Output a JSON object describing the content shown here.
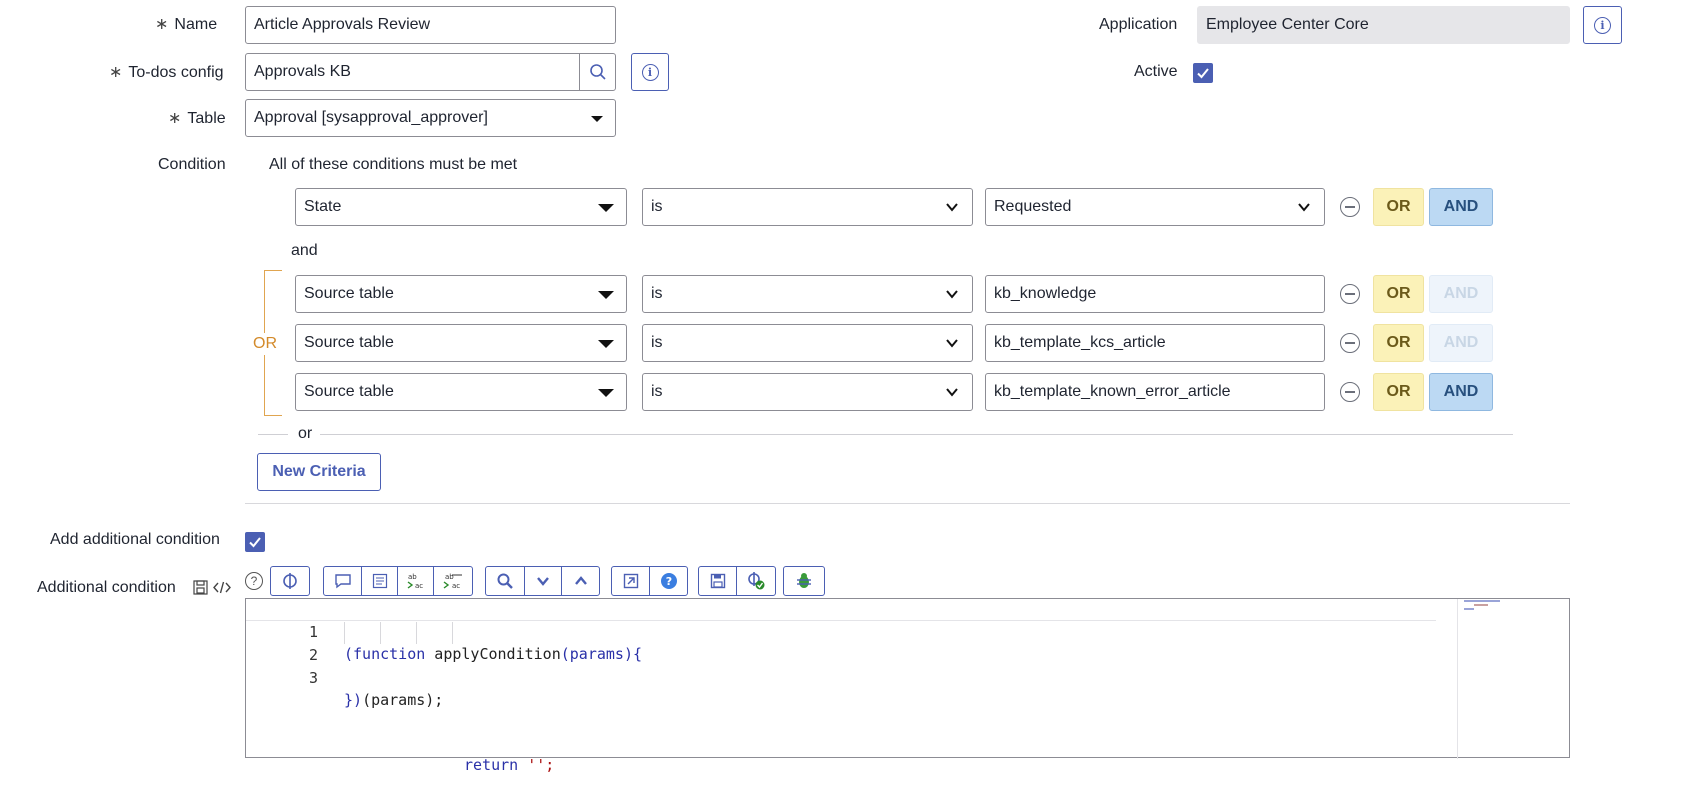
{
  "form": {
    "name_label": "Name",
    "name_value": "Article Approvals Review",
    "todos_label": "To-dos config",
    "todos_value": "Approvals KB",
    "table_label": "Table",
    "table_value": "Approval [sysapproval_approver]",
    "application_label": "Application",
    "application_value": "Employee Center Core",
    "active_label": "Active",
    "active_checked": true,
    "required_marker": "∗"
  },
  "condition": {
    "label": "Condition",
    "header": "All of these conditions must be met",
    "and_text": "and",
    "or_group_label": "OR",
    "or_separator": "or",
    "or_btn": "OR",
    "and_btn": "AND",
    "new_criteria": "New Criteria",
    "rows": [
      {
        "field": "State",
        "operator": "is",
        "value": "Requested",
        "value_type": "select",
        "and_enabled": true
      },
      {
        "field": "Source table",
        "operator": "is",
        "value": "kb_knowledge",
        "value_type": "text",
        "and_enabled": false
      },
      {
        "field": "Source table",
        "operator": "is",
        "value": "kb_template_kcs_article",
        "value_type": "text",
        "and_enabled": false
      },
      {
        "field": "Source table",
        "operator": "is",
        "value": "kb_template_known_error_article",
        "value_type": "text",
        "and_enabled": true
      }
    ]
  },
  "additional": {
    "add_label": "Add additional condition",
    "add_checked": true,
    "condition_label": "Additional condition",
    "toolbar_icons": [
      "help-icon",
      "script-assist-icon",
      "comment-icon",
      "format-icon",
      "replace-icon",
      "replace-all-icon",
      "search-icon",
      "scroll-down-icon",
      "scroll-up-icon",
      "fullscreen-icon",
      "help-circle-icon",
      "save-icon",
      "script-check-icon",
      "debug-icon"
    ],
    "code": {
      "line_numbers": [
        "1",
        "2",
        "3"
      ],
      "line1_kw": "(function",
      "line1_rest": " applyCondition",
      "line1_params": "(params){",
      "line2_kw": "return",
      "line2_str": " '';",
      "line3_a": "})",
      "line3_b": "(params);"
    }
  },
  "colors": {
    "accent": "#4b5fb3",
    "or_bg": "#fbf2b8",
    "and_bg": "#bcd9f3",
    "or_group": "#d38a2a"
  }
}
